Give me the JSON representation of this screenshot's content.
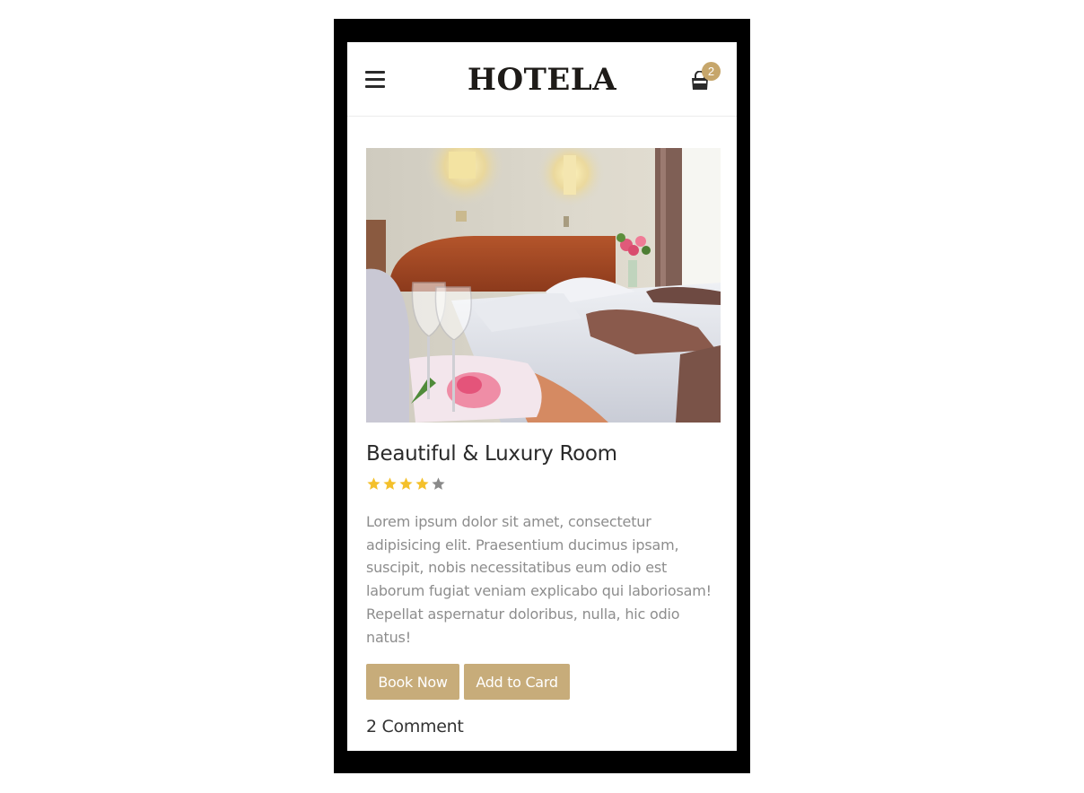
{
  "header": {
    "logo": "HOTELA",
    "cart_count": "2"
  },
  "room": {
    "title": "Beautiful & Luxury Room",
    "rating": 4,
    "rating_max": 5,
    "description": "Lorem ipsum dolor sit amet, consectetur adipisicing elit. Praesentium ducimus ipsam, suscipit, nobis necessitatibus eum odio est laborum fugiat veniam explicabo qui laboriosam! Repellat aspernatur doloribus, nulla, hic odio natus!",
    "book_label": "Book Now",
    "add_label": "Add to Card",
    "comments": "2 Comment"
  },
  "icons": {
    "menu": "hamburger-menu-icon",
    "cart": "shopping-bag-icon",
    "star": "star-icon"
  },
  "colors": {
    "accent": "#c7ac7a",
    "star_filled": "#f4c02b",
    "star_empty": "#8a8a8a",
    "title": "#2a2a2a",
    "body_text": "#8d8d8d"
  }
}
